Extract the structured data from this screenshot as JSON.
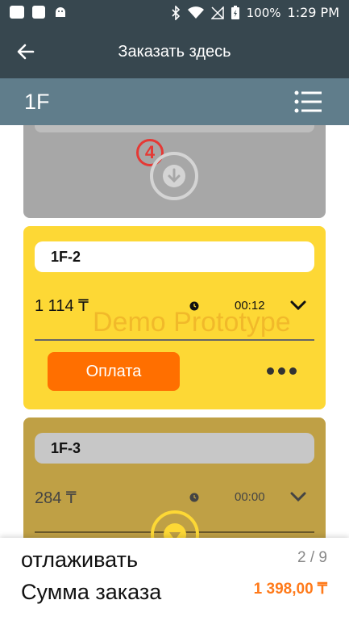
{
  "status_bar": {
    "battery": "100%",
    "time": "1:29 PM"
  },
  "toolbar": {
    "title": "Заказать здесь"
  },
  "header": {
    "label": "1F"
  },
  "step_badge": "4",
  "orders": [
    {
      "name": "1F-2",
      "amount": "1 114 ₸",
      "time": "00:12",
      "pay_label": "Оплата",
      "watermark": "Demo Prototype"
    },
    {
      "name": "1F-3",
      "amount": "284 ₸",
      "time": "00:00"
    }
  ],
  "summary": {
    "label_debug": "отлаживать",
    "label_total": "Сумма заказа",
    "page": "2 / 9",
    "total": "1 398,00 ₸"
  },
  "colors": {
    "toolbar": "#37474f",
    "header": "#607d8b",
    "card_active": "#fdd835",
    "card_olive": "#bfa045",
    "accent": "#ff6f00"
  }
}
